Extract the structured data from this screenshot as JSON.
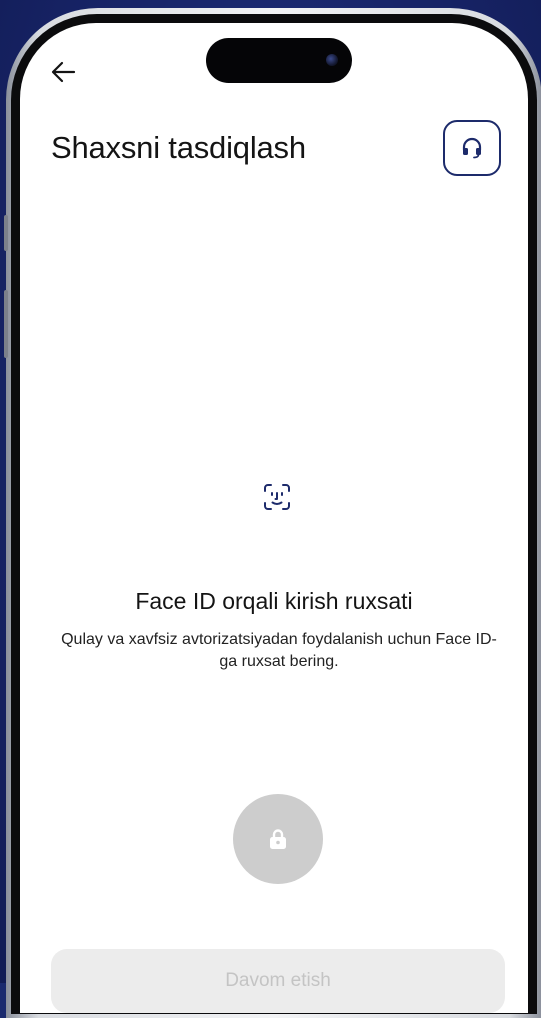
{
  "header": {
    "title": "Shaxsni tasdiqlash",
    "back_icon": "arrow-left-icon",
    "support_icon": "headset-icon"
  },
  "main": {
    "icon": "face-id-icon",
    "headline": "Face ID orqali kirish ruxsati",
    "description": "Qulay va xavfsiz avtorizatsiyadan foydalanish uchun Face ID-ga ruxsat bering.",
    "lock_icon": "lock-icon"
  },
  "footer": {
    "continue_label": "Davom etish"
  },
  "colors": {
    "accent": "#1d2b6b",
    "background": "#1b2a6e",
    "disabled_button": "#ececec",
    "lock_circle": "#cdcdcd"
  }
}
